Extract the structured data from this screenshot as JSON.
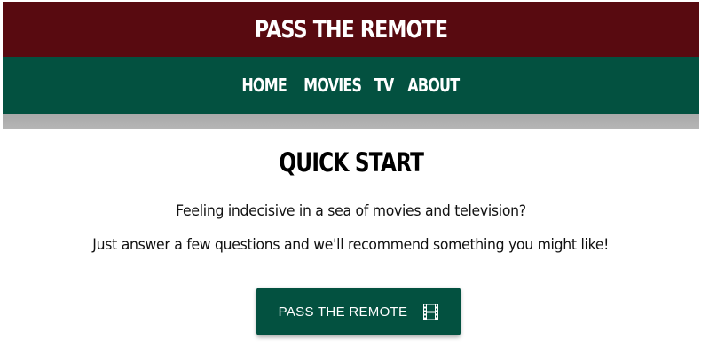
{
  "header": {
    "site_title": "PASS THE REMOTE"
  },
  "nav": {
    "items": [
      {
        "label": "HOME"
      },
      {
        "label": "MOVIES"
      },
      {
        "label": "TV"
      },
      {
        "label": "ABOUT"
      }
    ]
  },
  "main": {
    "heading": "QUICK START",
    "line1": "Feeling indecisive in a sea of movies and television?",
    "line2": "Just answer a few questions and we'll recommend something you might like!",
    "cta": {
      "label": "PASS THE REMOTE",
      "icon": "film-icon"
    }
  },
  "colors": {
    "title_bar": "#580a10",
    "nav_bar": "#035140",
    "button": "#035140",
    "text": "#111111"
  }
}
